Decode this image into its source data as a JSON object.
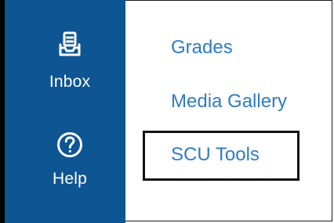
{
  "sidebar": {
    "items": [
      {
        "label": "Inbox",
        "icon": "inbox-icon"
      },
      {
        "label": "Help",
        "icon": "help-icon"
      }
    ],
    "background_color": "#0e5594"
  },
  "menu": {
    "links": [
      {
        "label": "Grades"
      },
      {
        "label": "Media Gallery"
      },
      {
        "label": "SCU Tools",
        "highlighted": true
      }
    ],
    "link_color": "#2d7cc4"
  }
}
